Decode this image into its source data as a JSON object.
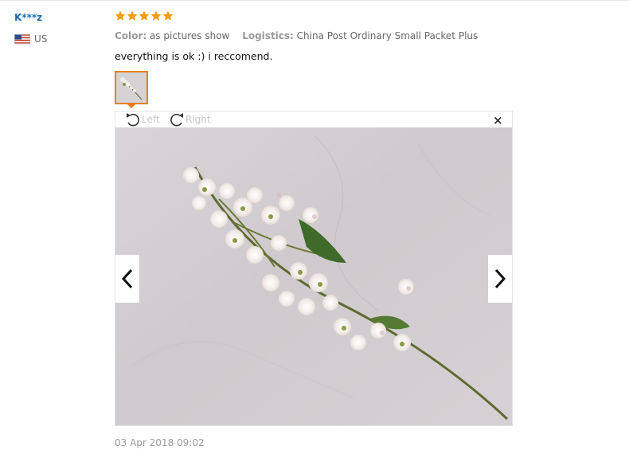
{
  "review": {
    "user_name": "K***z",
    "country": "US",
    "rating": 5,
    "rating_color": "#f39c12",
    "attributes": [
      {
        "key": "Color:",
        "value": "as pictures show"
      },
      {
        "key": "Logistics:",
        "value": "China Post Ordinary Small Packet Plus"
      }
    ],
    "text": "everything is ok :) i reccomend.",
    "date": "03 Apr 2018 09:02"
  },
  "viewer": {
    "rotate_left_label": "Left",
    "rotate_right_label": "Right",
    "close_label": "×",
    "accent_color": "#e8801a"
  },
  "icons": {
    "flag": "us-flag-icon",
    "star": "star-icon",
    "rotate_left": "rotate-left-icon",
    "rotate_right": "rotate-right-icon",
    "prev": "chevron-left-icon",
    "next": "chevron-right-icon",
    "close": "close-icon"
  }
}
